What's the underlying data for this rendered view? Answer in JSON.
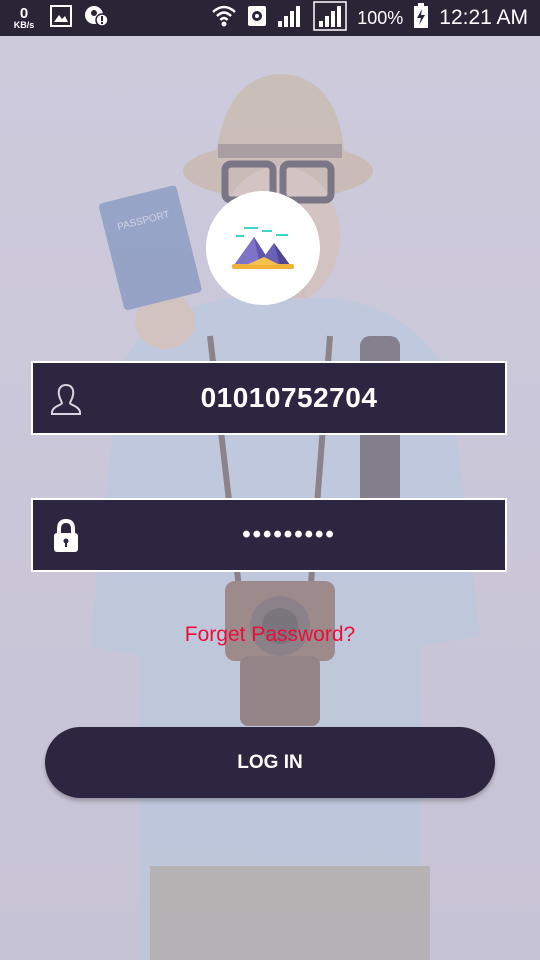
{
  "status_bar": {
    "speed_value": "0",
    "speed_unit": "KB/s",
    "battery_percent": "100%",
    "time": "12:21 AM",
    "icons": [
      "gallery-icon",
      "notification-alert-icon",
      "wifi-icon",
      "location-icon",
      "signal-icon",
      "signal-icon",
      "battery-charging-icon"
    ]
  },
  "login": {
    "username_value": "01010752704",
    "password_value": "•••••••••",
    "forget_password_label": "Forget Password?",
    "login_button_label": "LOG IN"
  },
  "colors": {
    "status_bar_bg": "#2a2437",
    "field_bg": "#2d2640",
    "button_bg": "#2d2640",
    "link_red": "#ea0e3a",
    "background_tint": "#c9c6d8"
  },
  "icons": {
    "logo": "mountains-logo-icon",
    "username": "user-icon",
    "password": "lock-icon"
  }
}
